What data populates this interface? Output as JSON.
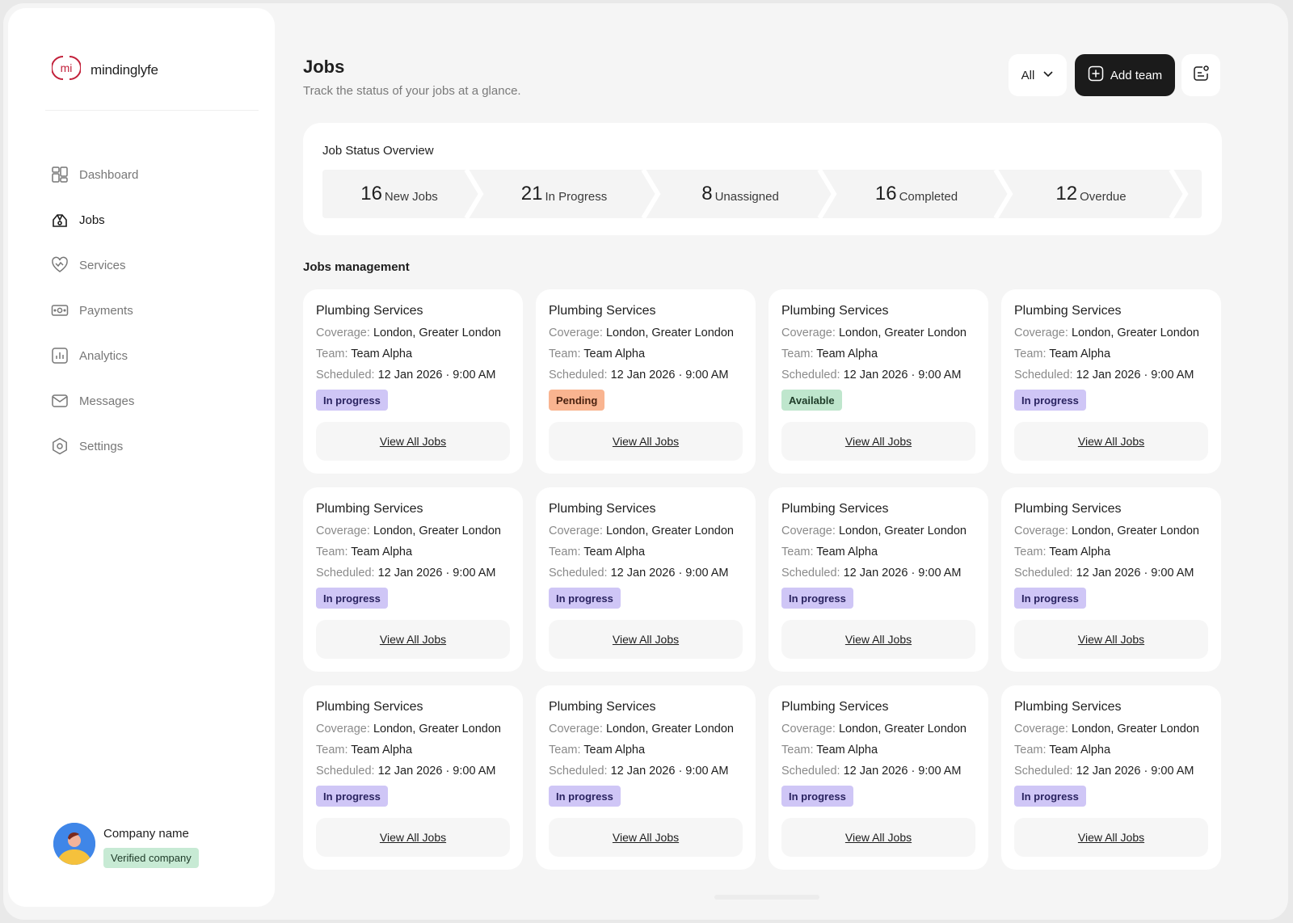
{
  "brand": {
    "name": "mindinglyfe",
    "accent": "#c2203a"
  },
  "sidebar": {
    "items": [
      {
        "label": "Dashboard",
        "icon": "dashboard-icon",
        "active": false
      },
      {
        "label": "Jobs",
        "icon": "jobs-icon",
        "active": true
      },
      {
        "label": "Services",
        "icon": "services-icon",
        "active": false
      },
      {
        "label": "Payments",
        "icon": "payments-icon",
        "active": false
      },
      {
        "label": "Analytics",
        "icon": "analytics-icon",
        "active": false
      },
      {
        "label": "Messages",
        "icon": "messages-icon",
        "active": false
      },
      {
        "label": "Settings",
        "icon": "settings-icon",
        "active": false
      }
    ],
    "profile": {
      "name": "Company name",
      "badge": "Verified company"
    }
  },
  "header": {
    "title": "Jobs",
    "subtitle": "Track the status of your jobs at a glance.",
    "filter_value": "All",
    "add_label": "Add team"
  },
  "overview": {
    "title": "Job Status Overview",
    "segments": [
      {
        "count": "16",
        "label": "New Jobs"
      },
      {
        "count": "21",
        "label": "In Progress"
      },
      {
        "count": "8",
        "label": "Unassigned"
      },
      {
        "count": "16",
        "label": "Completed"
      },
      {
        "count": "12",
        "label": "Overdue"
      }
    ]
  },
  "management": {
    "title": "Jobs management",
    "cards": [
      {
        "title": "Plumbing Services",
        "coverage_label": "Coverage:",
        "coverage": "London, Greater London",
        "team_label": "Team:",
        "team": "Team Alpha",
        "scheduled_label": "Scheduled:",
        "scheduled": "12 Jan 2026 · 9:00 AM",
        "status": "In progress",
        "status_type": "progress",
        "action": "View All Jobs"
      },
      {
        "title": "Plumbing Services",
        "coverage_label": "Coverage:",
        "coverage": "London, Greater London",
        "team_label": "Team:",
        "team": "Team Alpha",
        "scheduled_label": "Scheduled:",
        "scheduled": "12 Jan 2026 · 9:00 AM",
        "status": "Pending",
        "status_type": "pending",
        "action": "View All Jobs"
      },
      {
        "title": "Plumbing Services",
        "coverage_label": "Coverage:",
        "coverage": "London, Greater London",
        "team_label": "Team:",
        "team": "Team Alpha",
        "scheduled_label": "Scheduled:",
        "scheduled": "12 Jan 2026 · 9:00 AM",
        "status": "Available",
        "status_type": "available",
        "action": "View All Jobs"
      },
      {
        "title": "Plumbing Services",
        "coverage_label": "Coverage:",
        "coverage": "London, Greater London",
        "team_label": "Team:",
        "team": "Team Alpha",
        "scheduled_label": "Scheduled:",
        "scheduled": "12 Jan 2026 · 9:00 AM",
        "status": "In progress",
        "status_type": "progress",
        "action": "View All Jobs"
      },
      {
        "title": "Plumbing Services",
        "coverage_label": "Coverage:",
        "coverage": "London, Greater London",
        "team_label": "Team:",
        "team": "Team Alpha",
        "scheduled_label": "Scheduled:",
        "scheduled": "12 Jan 2026 · 9:00 AM",
        "status": "In progress",
        "status_type": "progress",
        "action": "View All Jobs"
      },
      {
        "title": "Plumbing Services",
        "coverage_label": "Coverage:",
        "coverage": "London, Greater London",
        "team_label": "Team:",
        "team": "Team Alpha",
        "scheduled_label": "Scheduled:",
        "scheduled": "12 Jan 2026 · 9:00 AM",
        "status": "In progress",
        "status_type": "progress",
        "action": "View All Jobs"
      },
      {
        "title": "Plumbing Services",
        "coverage_label": "Coverage:",
        "coverage": "London, Greater London",
        "team_label": "Team:",
        "team": "Team Alpha",
        "scheduled_label": "Scheduled:",
        "scheduled": "12 Jan 2026 · 9:00 AM",
        "status": "In progress",
        "status_type": "progress",
        "action": "View All Jobs"
      },
      {
        "title": "Plumbing Services",
        "coverage_label": "Coverage:",
        "coverage": "London, Greater London",
        "team_label": "Team:",
        "team": "Team Alpha",
        "scheduled_label": "Scheduled:",
        "scheduled": "12 Jan 2026 · 9:00 AM",
        "status": "In progress",
        "status_type": "progress",
        "action": "View All Jobs"
      },
      {
        "title": "Plumbing Services",
        "coverage_label": "Coverage:",
        "coverage": "London, Greater London",
        "team_label": "Team:",
        "team": "Team Alpha",
        "scheduled_label": "Scheduled:",
        "scheduled": "12 Jan 2026 · 9:00 AM",
        "status": "In progress",
        "status_type": "progress",
        "action": "View All Jobs"
      },
      {
        "title": "Plumbing Services",
        "coverage_label": "Coverage:",
        "coverage": "London, Greater London",
        "team_label": "Team:",
        "team": "Team Alpha",
        "scheduled_label": "Scheduled:",
        "scheduled": "12 Jan 2026 · 9:00 AM",
        "status": "In progress",
        "status_type": "progress",
        "action": "View All Jobs"
      },
      {
        "title": "Plumbing Services",
        "coverage_label": "Coverage:",
        "coverage": "London, Greater London",
        "team_label": "Team:",
        "team": "Team Alpha",
        "scheduled_label": "Scheduled:",
        "scheduled": "12 Jan 2026 · 9:00 AM",
        "status": "In progress",
        "status_type": "progress",
        "action": "View All Jobs"
      },
      {
        "title": "Plumbing Services",
        "coverage_label": "Coverage:",
        "coverage": "London, Greater London",
        "team_label": "Team:",
        "team": "Team Alpha",
        "scheduled_label": "Scheduled:",
        "scheduled": "12 Jan 2026 · 9:00 AM",
        "status": "In progress",
        "status_type": "progress",
        "action": "View All Jobs"
      }
    ]
  }
}
